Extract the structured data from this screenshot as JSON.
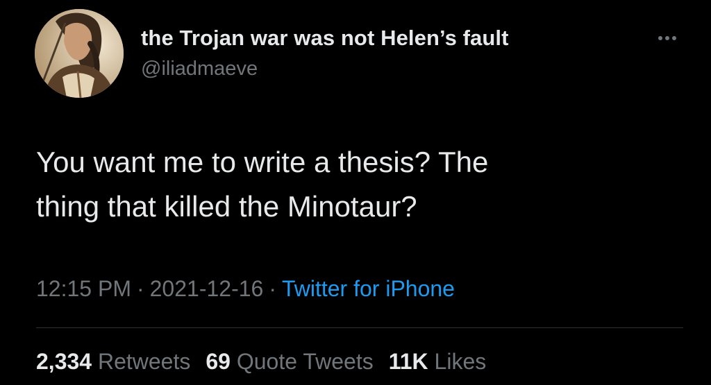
{
  "author": {
    "display_name": "the Trojan war was not Helen’s fault",
    "handle": "@iliadmaeve",
    "avatar_icon": "avatar-warrior-portrait"
  },
  "tweet": {
    "text": "You want me to write a thesis? The\nthing that killed the Minotaur?"
  },
  "meta": {
    "time": "12:15 PM",
    "date": "2021-12-16",
    "separator": "·",
    "source": "Twitter for iPhone"
  },
  "stats": {
    "retweets_count": "2,334",
    "retweets_label": "Retweets",
    "quotes_count": "69",
    "quotes_label": "Quote Tweets",
    "likes_count": "11K",
    "likes_label": "Likes"
  },
  "colors": {
    "background": "#000000",
    "primary_text": "#e7e9ea",
    "secondary_text": "#71767b",
    "link": "#1d9bf0",
    "divider": "#2f3336"
  },
  "icons": {
    "more": "more-horizontal-icon"
  }
}
